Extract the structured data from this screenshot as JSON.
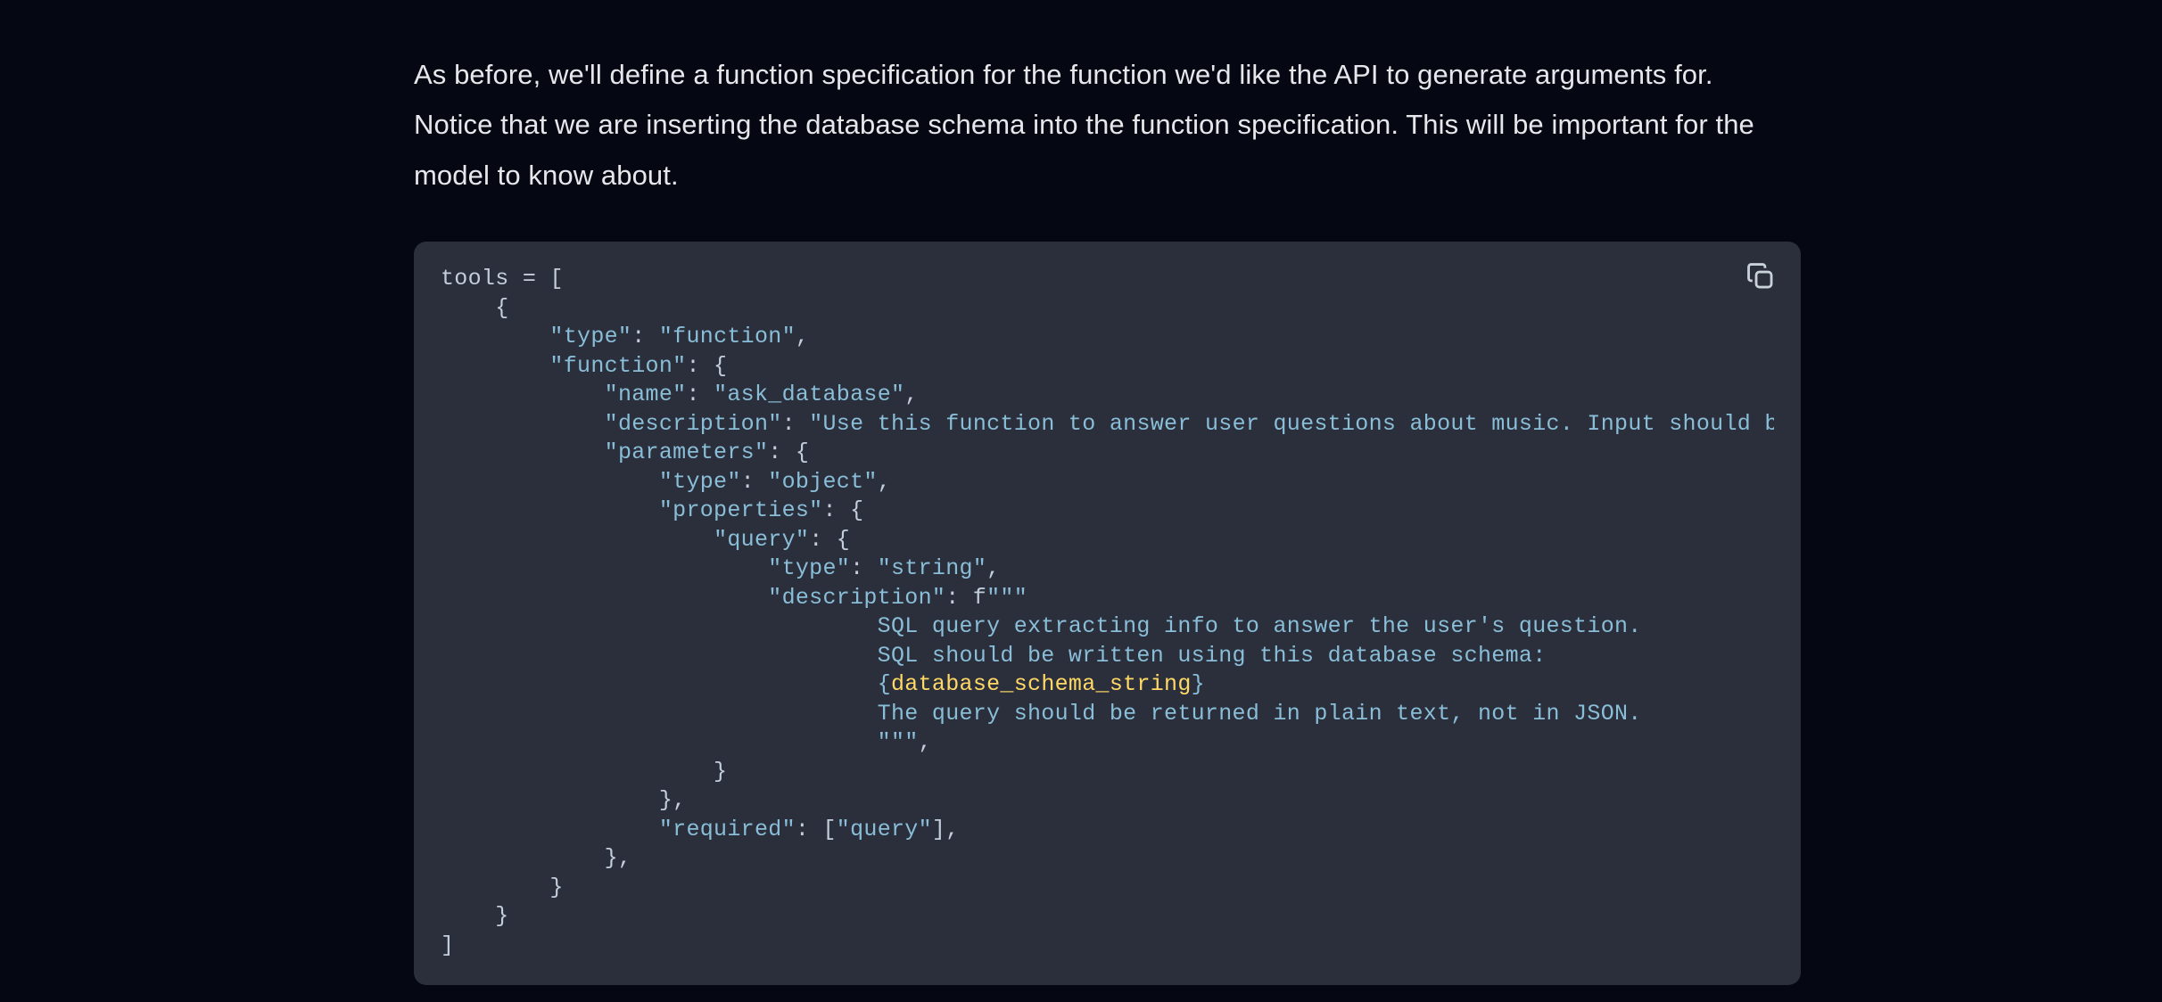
{
  "prose": {
    "paragraph": "As before, we'll define a function specification for the function we'd like the API to generate arguments for. Notice that we are inserting the database schema into the function specification. This will be important for the model to know about."
  },
  "code": {
    "l01_a": "tools ",
    "l01_b": "=",
    "l01_c": " [",
    "l02": "    {",
    "l03_a": "        ",
    "l03_b": "\"type\"",
    "l03_c": ": ",
    "l03_d": "\"function\"",
    "l03_e": ",",
    "l04_a": "        ",
    "l04_b": "\"function\"",
    "l04_c": ": {",
    "l05_a": "            ",
    "l05_b": "\"name\"",
    "l05_c": ": ",
    "l05_d": "\"ask_database\"",
    "l05_e": ",",
    "l06_a": "            ",
    "l06_b": "\"description\"",
    "l06_c": ": ",
    "l06_d": "\"Use this function to answer user questions about music. Input should be a fu",
    "l07_a": "            ",
    "l07_b": "\"parameters\"",
    "l07_c": ": {",
    "l08_a": "                ",
    "l08_b": "\"type\"",
    "l08_c": ": ",
    "l08_d": "\"object\"",
    "l08_e": ",",
    "l09_a": "                ",
    "l09_b": "\"properties\"",
    "l09_c": ": {",
    "l10_a": "                    ",
    "l10_b": "\"query\"",
    "l10_c": ": {",
    "l11_a": "                        ",
    "l11_b": "\"type\"",
    "l11_c": ": ",
    "l11_d": "\"string\"",
    "l11_e": ",",
    "l12_a": "                        ",
    "l12_b": "\"description\"",
    "l12_c": ": f",
    "l12_d": "\"\"\"",
    "l13": "                                SQL query extracting info to answer the user's question.",
    "l14": "                                SQL should be written using this database schema:",
    "l15_a": "                                ",
    "l15_b": "{",
    "l15_c": "database_schema_string",
    "l15_d": "}",
    "l16": "                                The query should be returned in plain text, not in JSON.",
    "l17_a": "                                \"\"\"",
    "l17_b": ",",
    "l18": "                    }",
    "l19": "                },",
    "l20_a": "                ",
    "l20_b": "\"required\"",
    "l20_c": ": [",
    "l20_d": "\"query\"",
    "l20_e": "],",
    "l21": "            },",
    "l22": "        }",
    "l23": "    }",
    "l24": "]"
  },
  "icons": {
    "copy": "copy-icon"
  }
}
